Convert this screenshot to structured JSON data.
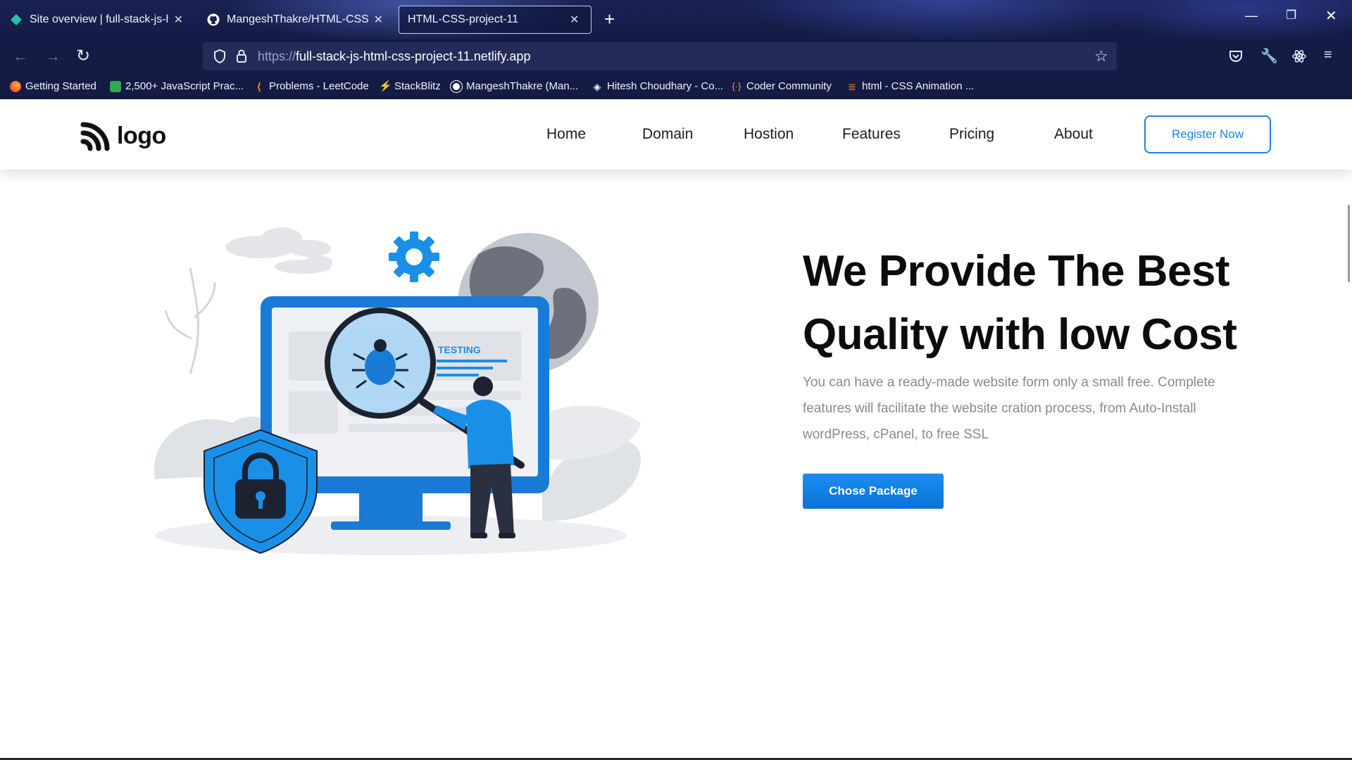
{
  "browser": {
    "tabs": [
      {
        "title": "Site overview | full-stack-js-html",
        "icon": "netlify-diamond-icon",
        "active": false
      },
      {
        "title": "MangeshThakre/HTML-CSS-Pro",
        "icon": "github-icon",
        "active": false
      },
      {
        "title": "HTML-CSS-project-11",
        "icon": "",
        "active": true
      }
    ],
    "new_tab_label": "+",
    "url_protocol": "https://",
    "url_host": "full-stack-js-html-css-project-11.netlify.app",
    "bookmarks": [
      {
        "label": "Getting Started",
        "icon": "firefox-icon"
      },
      {
        "label": "2,500+ JavaScript Prac...",
        "icon": "puzzle-icon"
      },
      {
        "label": "Problems - LeetCode",
        "icon": "leetcode-icon"
      },
      {
        "label": "StackBlitz",
        "icon": "bolt-icon"
      },
      {
        "label": "MangeshThakre (Man...",
        "icon": "github-icon"
      },
      {
        "label": "Hitesh Choudhary - Co...",
        "icon": "codepen-icon"
      },
      {
        "label": "Coder Community",
        "icon": "code-braces-icon"
      },
      {
        "label": "html - CSS Animation ...",
        "icon": "stackoverflow-icon"
      }
    ]
  },
  "site": {
    "logo_text": "logo",
    "nav": [
      "Home",
      "Domain",
      "Hostion",
      "Features",
      "Pricing",
      "About"
    ],
    "register_label": "Register Now",
    "hero": {
      "title_line1": "We Provide The Best",
      "title_line2": "Quality with low Cost",
      "description": "You can have a ready-made website form only a small free. Complete features will facilitate the website cration process, from Auto-Install wordPress, cPanel, to free SSL",
      "cta_label": "Chose Package",
      "illustration_label": "TESTING"
    }
  },
  "colors": {
    "accent": "#1a86e6",
    "chrome_bg": "#141b44",
    "title": "#0c0c0c",
    "body_text": "#8a8a8a"
  }
}
